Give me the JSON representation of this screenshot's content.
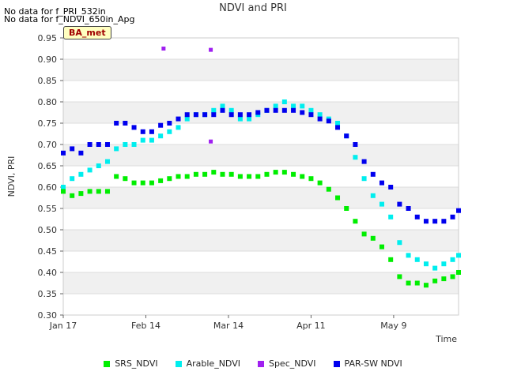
{
  "notes": [
    "No data for f_PRI_532in",
    "No data for f_NDVI_650in_Apg"
  ],
  "badge": "BA_met",
  "chart_data": {
    "type": "scatter",
    "title": "NDVI and PRI",
    "xlabel": "Time",
    "ylabel": "NDVI, PRI",
    "ylim": [
      0.3,
      0.95
    ],
    "yticks": [
      "0.30",
      "0.35",
      "0.40",
      "0.45",
      "0.50",
      "0.55",
      "0.60",
      "0.65",
      "0.70",
      "0.75",
      "0.80",
      "0.85",
      "0.90",
      "0.95"
    ],
    "xlim_days": [
      0,
      72
    ],
    "xticks": [
      {
        "day": 0,
        "label": "Jan 17"
      },
      {
        "day": 28,
        "label": "Feb 14"
      },
      {
        "day": 56,
        "label": "Mar 14"
      },
      {
        "day": 84,
        "label": "Apr 11"
      },
      {
        "day": 112,
        "label": "May 9"
      }
    ],
    "grid": "horizontal alternating bands",
    "legend_position": "bottom",
    "series": [
      {
        "name": "SRS_NDVI",
        "color": "#00ee00",
        "x": [
          0,
          3,
          6,
          9,
          12,
          15,
          18,
          21,
          24,
          27,
          30,
          33,
          36,
          39,
          42,
          45,
          48,
          51,
          54,
          57,
          60,
          63,
          66,
          69,
          72,
          75,
          78,
          81,
          84,
          87,
          90,
          93,
          96,
          99,
          102,
          105,
          108,
          111,
          114,
          117,
          120,
          123,
          126,
          129,
          132,
          134
        ],
        "y": [
          0.59,
          0.58,
          0.585,
          0.59,
          0.59,
          0.59,
          0.625,
          0.62,
          0.61,
          0.61,
          0.61,
          0.615,
          0.62,
          0.625,
          0.625,
          0.63,
          0.63,
          0.635,
          0.63,
          0.63,
          0.625,
          0.625,
          0.625,
          0.63,
          0.635,
          0.635,
          0.63,
          0.625,
          0.62,
          0.61,
          0.595,
          0.575,
          0.55,
          0.52,
          0.49,
          0.48,
          0.46,
          0.43,
          0.39,
          0.375,
          0.375,
          0.37,
          0.38,
          0.385,
          0.39,
          0.4
        ]
      },
      {
        "name": "Arable_NDVI",
        "color": "#00eeee",
        "x": [
          0,
          3,
          6,
          9,
          12,
          15,
          18,
          21,
          24,
          27,
          30,
          33,
          36,
          39,
          42,
          45,
          48,
          51,
          54,
          57,
          60,
          63,
          66,
          69,
          72,
          75,
          78,
          81,
          84,
          87,
          90,
          93,
          96,
          99,
          102,
          105,
          108,
          111,
          114,
          117,
          120,
          123,
          126,
          129,
          132,
          134
        ],
        "y": [
          0.6,
          0.62,
          0.63,
          0.64,
          0.65,
          0.66,
          0.69,
          0.7,
          0.7,
          0.71,
          0.71,
          0.72,
          0.73,
          0.74,
          0.76,
          0.77,
          0.77,
          0.78,
          0.79,
          0.78,
          0.76,
          0.76,
          0.77,
          0.78,
          0.79,
          0.8,
          0.79,
          0.79,
          0.78,
          0.77,
          0.76,
          0.75,
          0.72,
          0.67,
          0.62,
          0.58,
          0.56,
          0.53,
          0.47,
          0.44,
          0.43,
          0.42,
          0.41,
          0.42,
          0.43,
          0.44
        ]
      },
      {
        "name": "Spec_NDVI",
        "color": "#a020f0",
        "x": [
          34,
          50,
          50
        ],
        "y": [
          0.925,
          0.922,
          0.707
        ]
      },
      {
        "name": "PAR-SW NDVI",
        "color": "#0000ee",
        "x": [
          0,
          3,
          6,
          9,
          12,
          15,
          18,
          21,
          24,
          27,
          30,
          33,
          36,
          39,
          42,
          45,
          48,
          51,
          54,
          57,
          60,
          63,
          66,
          69,
          72,
          75,
          78,
          81,
          84,
          87,
          90,
          93,
          96,
          99,
          102,
          105,
          108,
          111,
          114,
          117,
          120,
          123,
          126,
          129,
          132,
          134
        ],
        "y": [
          0.68,
          0.69,
          0.68,
          0.7,
          0.7,
          0.7,
          0.75,
          0.75,
          0.74,
          0.73,
          0.73,
          0.745,
          0.75,
          0.76,
          0.77,
          0.77,
          0.77,
          0.77,
          0.78,
          0.77,
          0.77,
          0.77,
          0.775,
          0.78,
          0.78,
          0.78,
          0.78,
          0.775,
          0.77,
          0.76,
          0.755,
          0.74,
          0.72,
          0.7,
          0.66,
          0.63,
          0.61,
          0.6,
          0.56,
          0.55,
          0.53,
          0.52,
          0.52,
          0.52,
          0.53,
          0.545
        ]
      }
    ]
  }
}
